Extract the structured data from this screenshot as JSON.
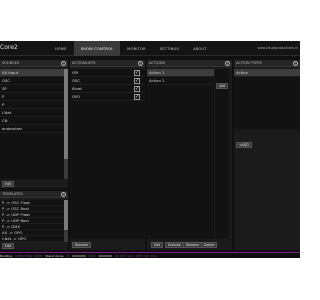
{
  "app": {
    "title": "Core2"
  },
  "nav": {
    "tabs": [
      {
        "label": "HOME",
        "active": false
      },
      {
        "label": "SHOW CONTROL",
        "active": true
      },
      {
        "label": "MONITOR",
        "active": false
      },
      {
        "label": "SETTINGS",
        "active": false
      },
      {
        "label": "ABOUT",
        "active": false
      }
    ],
    "site_url": "www.visualproductions.nl"
  },
  "sources": {
    "title": "SOURCES",
    "items": [
      "AX Input",
      "OSC",
      "SP",
      "P",
      "P",
      "I-Net",
      "CN",
      "andomizer"
    ],
    "button": "Edit"
  },
  "templates": {
    "title": "TEMPLATES",
    "items": [
      "P -> OSC Float",
      "P -> OSC Bool",
      "P -> UDP Float",
      "P -> UDP Bool",
      "P -> DMX",
      "AX -> GPO",
      "I-Net -> GPO"
    ],
    "button": "Edit"
  },
  "actionlists": {
    "title": "ACTIONLISTS",
    "items": [
      {
        "label": "GPI",
        "checked": true
      },
      {
        "label": "OSC",
        "checked": true
      },
      {
        "label": "Kinet",
        "checked": true
      },
      {
        "label": "GPO",
        "checked": true
      }
    ],
    "button": "Rename"
  },
  "actions": {
    "title": "ACTIONS",
    "items": [
      "Action 1",
      "Action 2"
    ],
    "side_button": "Add",
    "buttons": [
      "Edit",
      "Execute",
      "Rename",
      "Delete"
    ]
  },
  "action_types": {
    "title": "ACTION TYPES",
    "items": [
      "Action"
    ],
    "button": "<ADD"
  },
  "status": {
    "items": [
      {
        "key": "",
        "value": "Building"
      },
      {
        "key": "OPERATING MODE",
        "value": "Stand Alone"
      },
      {
        "key": "IP",
        "value": "0000000"
      },
      {
        "key": "DMX",
        "value": "0000000"
      }
    ],
    "markers": "IN OUT ACK VEP TCP OSC"
  },
  "colors": {
    "accent": "#7c1d8a",
    "background": "#101010",
    "panel": "#1b1b1b"
  },
  "icons": {
    "help": "help-icon",
    "check": "checkmark-icon"
  }
}
